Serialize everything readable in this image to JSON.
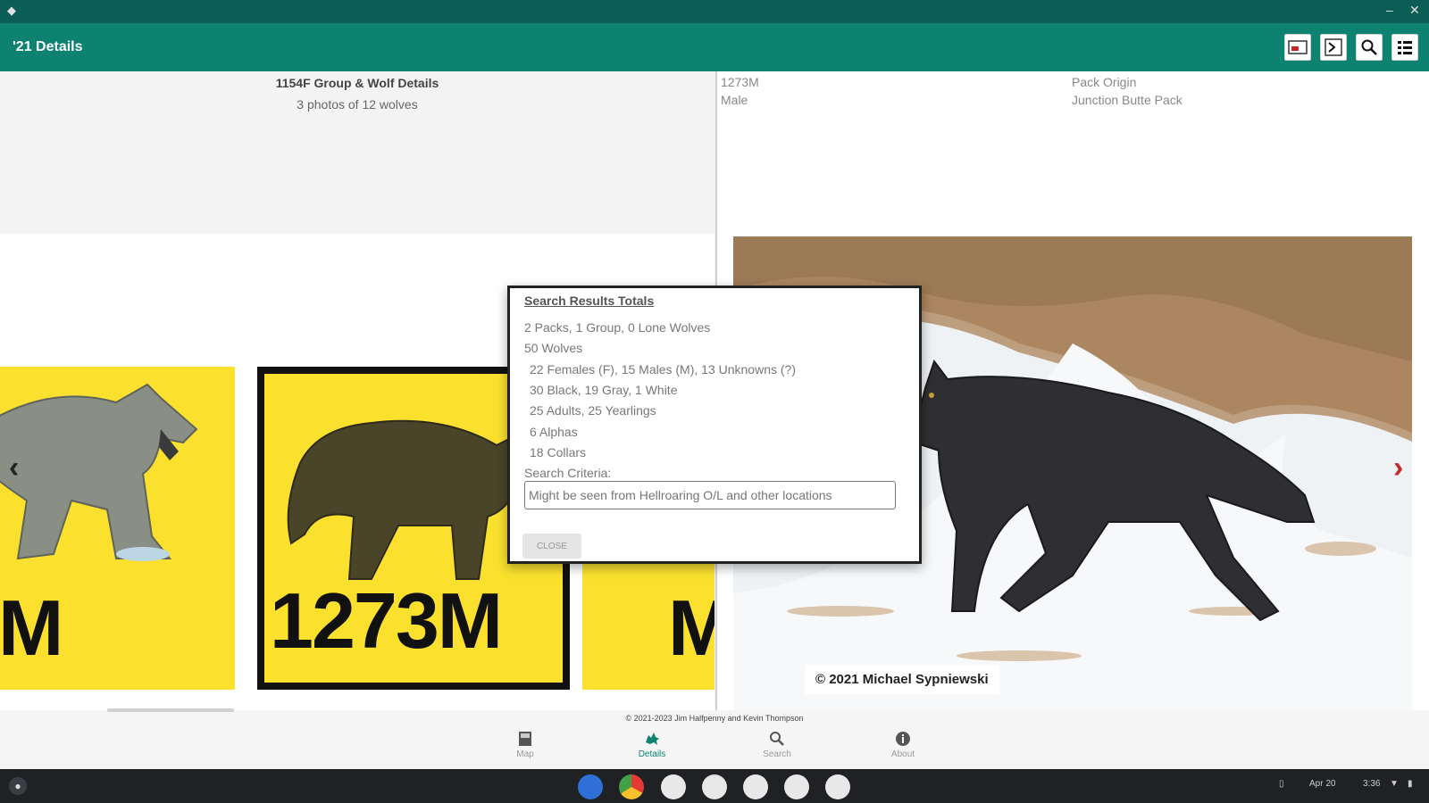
{
  "window": {
    "minimize_glyph": "–",
    "close_glyph": "✕"
  },
  "appbar": {
    "title": "'21 Details",
    "actions": [
      "map-pin-icon",
      "terminal-icon",
      "search-icon",
      "list-icon"
    ]
  },
  "left_panel": {
    "title": "1154F Group & Wolf Details",
    "subtitle": "3 photos of 12 wolves",
    "cards": [
      {
        "label": "M"
      },
      {
        "label": "1273M"
      },
      {
        "label": "M"
      }
    ]
  },
  "right_panel": {
    "wolf_id": "1273M",
    "sex": "Male",
    "pack_origin_label": "Pack Origin",
    "pack_origin_value": "Junction Butte Pack",
    "photo_credit": "© 2021 Michael Sypniewski"
  },
  "dialog": {
    "title": "Search Results Totals",
    "lines": [
      "2 Packs, 1 Group, 0 Lone Wolves",
      "50 Wolves",
      "22 Females (F), 15 Males (M), 13 Unknowns (?)",
      "30 Black, 19 Gray, 1 White",
      "25 Adults, 25 Yearlings",
      "6 Alphas",
      "18 Collars"
    ],
    "criteria_label": "Search Criteria:",
    "criteria_value": "Might be seen from Hellroaring O/L and other locations",
    "close_label": "CLOSE"
  },
  "footer": {
    "copyright": "© 2021-2023 Jim Halfpenny and Kevin Thompson"
  },
  "bottom_nav": [
    {
      "label": "Map",
      "icon": "map-icon",
      "active": false
    },
    {
      "label": "Details",
      "icon": "wolf-icon",
      "active": true
    },
    {
      "label": "Search",
      "icon": "search-icon",
      "active": false
    },
    {
      "label": "About",
      "icon": "info-icon",
      "active": false
    }
  ],
  "shelf": {
    "apps": [
      "settings-icon",
      "chrome-icon",
      "app-icon",
      "app-icon",
      "app-icon",
      "app-icon",
      "app-icon"
    ],
    "date": "Apr 20",
    "time": "3:36"
  },
  "colors": {
    "primary": "#0d8270",
    "title_bar": "#0b5e55",
    "card_yellow": "#fbe12e",
    "arrow_red": "#c62828"
  }
}
